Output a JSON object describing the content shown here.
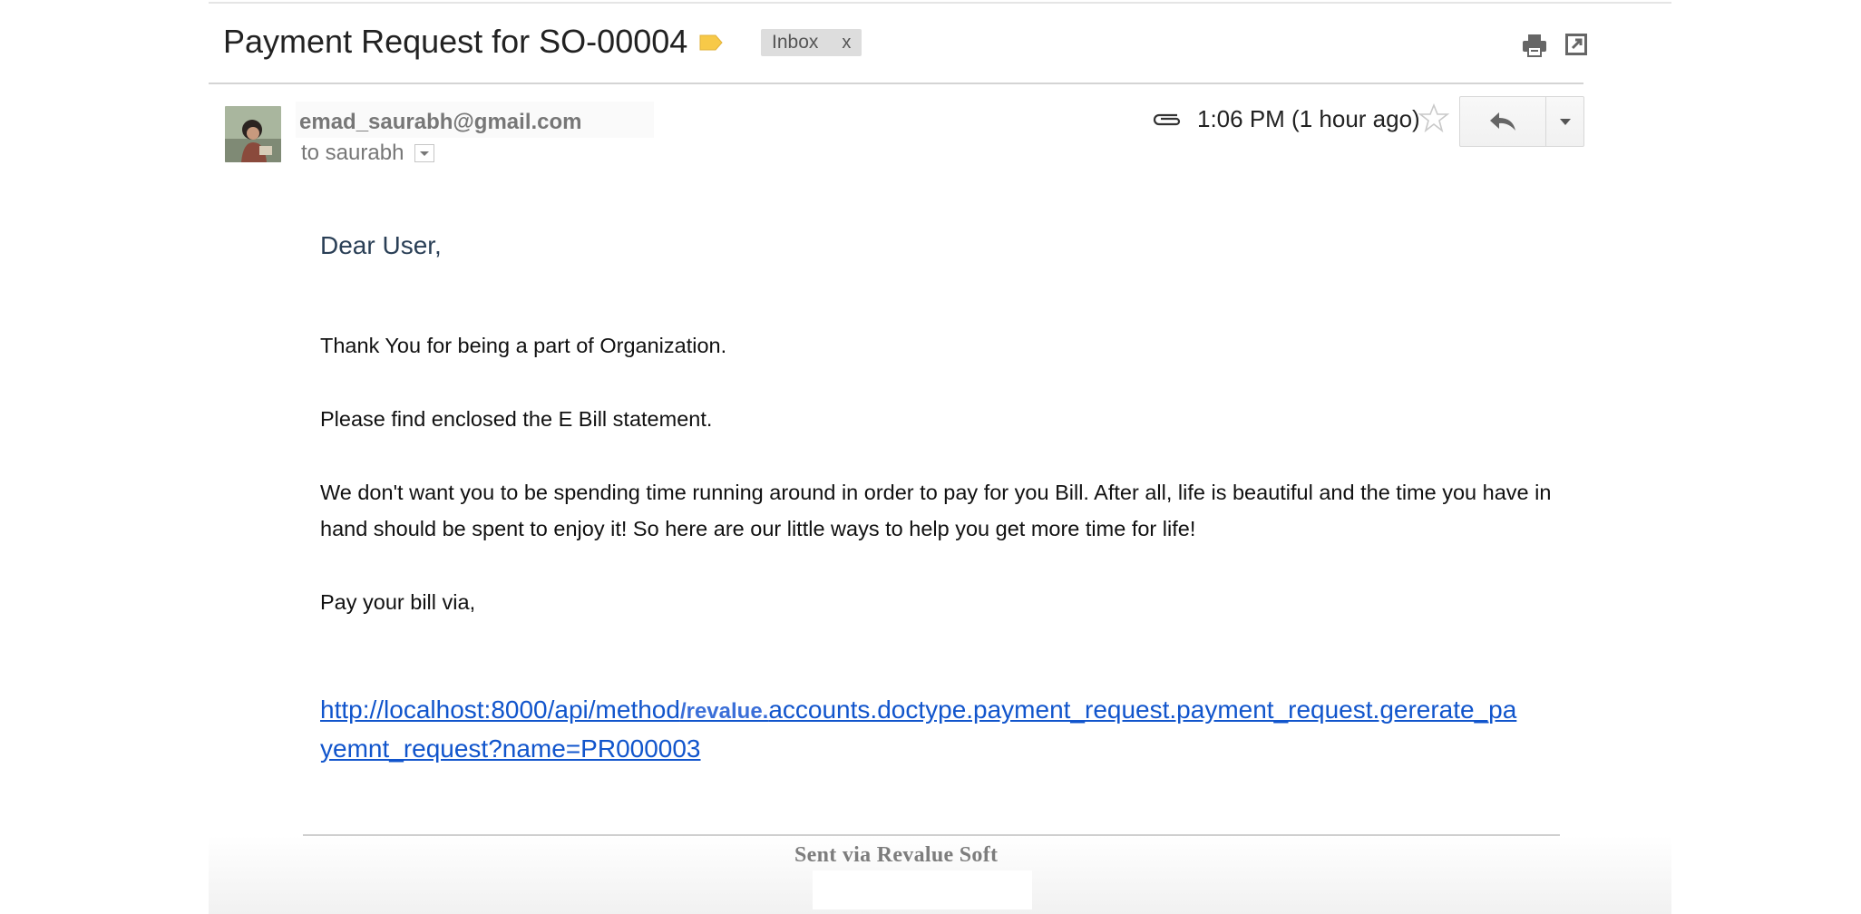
{
  "email": {
    "subject": "Payment Request for SO-00004",
    "label_chip": {
      "text": "Inbox",
      "remove": "x"
    },
    "sender": "emad_saurabh@gmail.com",
    "recipient_line": "to saurabh",
    "timestamp": "1:06 PM (1 hour ago)",
    "greeting": "Dear User,",
    "paragraphs": [
      "Thank You for being a part of Organization.",
      "Please find enclosed the E Bill statement.",
      "We don't want you to be spending time running around in order to pay for you Bill. After all, life is beautiful and the time you have in hand should be spent to enjoy it! So here are our little ways to help you get more time for life!",
      "Pay your bill via,"
    ],
    "link": {
      "before": "http://localhost:8000/api/method",
      "highlight": "/revalue.",
      "after": "accounts.doctype.payment_request.payment_request.gererate_payemnt_request?name=PR000003"
    },
    "footer": "Sent via Revalue Soft"
  },
  "icons": {
    "label": "label-tag-icon",
    "print": "print-icon",
    "popout": "new-window-icon",
    "attachment": "paperclip-icon",
    "star": "star-icon",
    "reply": "reply-arrow-icon",
    "more": "dropdown-caret-icon"
  },
  "colors": {
    "link": "#1155cc",
    "label_tag": "#f7c948",
    "chip_bg": "#dddddd",
    "sender_text": "#777777"
  }
}
